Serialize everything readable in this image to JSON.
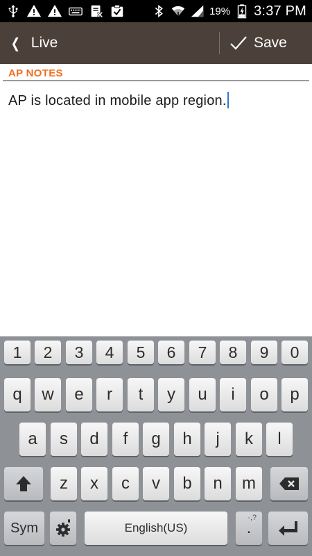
{
  "status_bar": {
    "left_icons": [
      "usb-icon",
      "warning-icon",
      "warning-icon",
      "keyboard-icon",
      "clipboard-x-icon",
      "clipboard-check-icon"
    ],
    "right_icons": [
      "bluetooth-icon",
      "wifi-icon",
      "signal-icon",
      "battery-icon"
    ],
    "battery_percent": "19%",
    "time": "3:37 PM"
  },
  "action_bar": {
    "back_label": "Live",
    "save_label": "Save",
    "background": "#4b403a"
  },
  "section": {
    "title": "AP NOTES",
    "accent_color": "#ee6f22"
  },
  "notes": {
    "value": "AP is located in mobile app region."
  },
  "keyboard": {
    "number_row": [
      "1",
      "2",
      "3",
      "4",
      "5",
      "6",
      "7",
      "8",
      "9",
      "0"
    ],
    "row1": [
      "q",
      "w",
      "e",
      "r",
      "t",
      "y",
      "u",
      "i",
      "o",
      "p"
    ],
    "row2": [
      "a",
      "s",
      "d",
      "f",
      "g",
      "h",
      "j",
      "k",
      "l"
    ],
    "row3": [
      "z",
      "x",
      "c",
      "v",
      "b",
      "n",
      "m"
    ],
    "sym_label": "Sym",
    "space_label": "English(US)",
    "period_label": ".",
    "period_hint": "·,?",
    "shift_icon": "shift-icon",
    "backspace_icon": "backspace-icon",
    "settings_icon": "gear-icon",
    "enter_icon": "enter-icon"
  }
}
